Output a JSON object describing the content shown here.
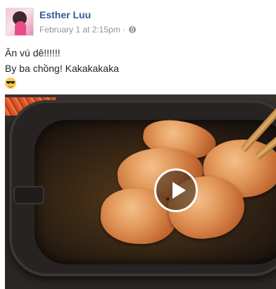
{
  "post": {
    "author": "Esther Luu",
    "date": "February 1 at 2:15pm",
    "separator": "·",
    "privacy_icon": "globe-icon",
    "text_lines": [
      "Ăn vú dê!!!!!!",
      "By ba chồng! Kakakakaka"
    ],
    "emoji": "sunglasses-emoji",
    "video": {
      "play_icon": "play-icon"
    }
  },
  "colors": {
    "author": "#365899",
    "meta": "#90949c",
    "text": "#1d2129"
  }
}
